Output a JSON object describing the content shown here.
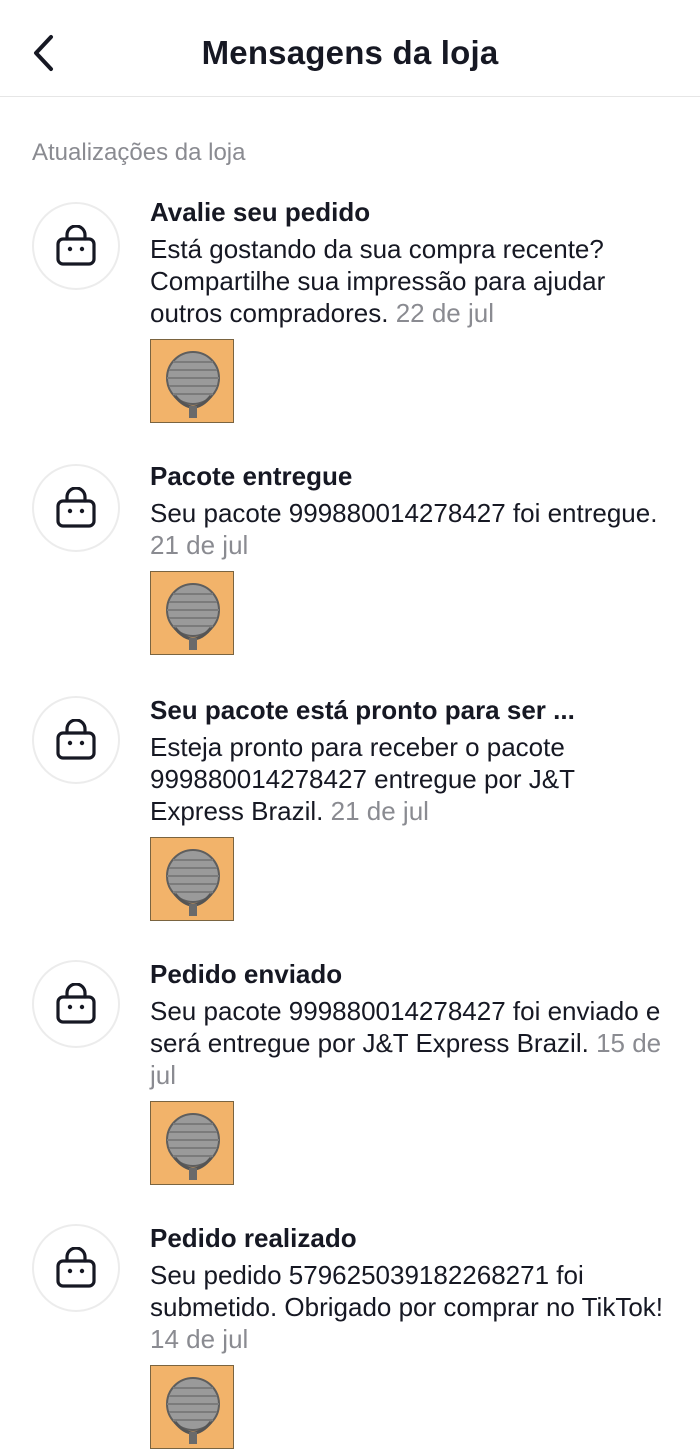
{
  "header": {
    "title": "Mensagens da loja",
    "back_icon": "chevron-left-icon"
  },
  "section": {
    "label": "Atualizações da loja"
  },
  "messages": [
    {
      "icon": "shopping-bag-icon",
      "title": "Avalie seu pedido",
      "text": "Está gostando da sua compra recente? Compartilhe sua impressão para ajudar outros compradores.",
      "date": "22 de jul"
    },
    {
      "icon": "shopping-bag-icon",
      "title": "Pacote entregue",
      "text": "Seu pacote 999880014278427 foi entregue.",
      "date": "21 de jul"
    },
    {
      "icon": "shopping-bag-icon",
      "title": "Seu pacote está pronto para ser ...",
      "text": "Esteja pronto para receber o pacote 999880014278427 entregue por J&T Express Brazil.",
      "date": "21 de jul"
    },
    {
      "icon": "shopping-bag-icon",
      "title": "Pedido enviado",
      "text": "Seu pacote 999880014278427 foi enviado e será entregue por J&T Express Brazil.",
      "date": "15 de jul"
    },
    {
      "icon": "shopping-bag-icon",
      "title": "Pedido realizado",
      "text": "Seu pedido 579625039182268271 foi submetido. Obrigado por comprar no TikTok!",
      "date": "14 de jul"
    }
  ],
  "colors": {
    "thumbnail_bg": "#f2b36a",
    "date_text": "#8a8b91",
    "primary_text": "#161823"
  }
}
